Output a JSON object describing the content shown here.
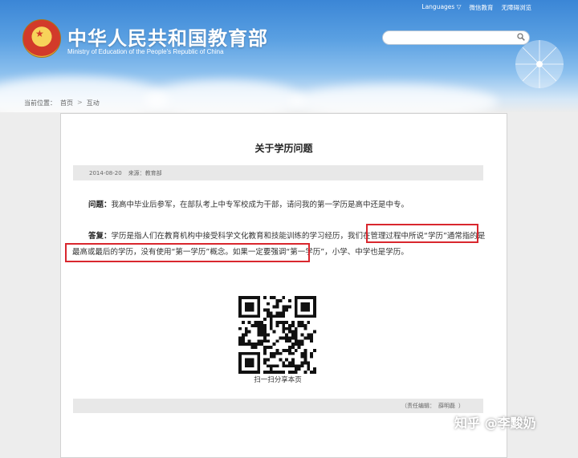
{
  "top_nav": {
    "languages": "Languages",
    "languages_caret": "▽",
    "mobile": "微信教育",
    "accessibility": "无障碍浏览"
  },
  "site": {
    "title": "中华人民共和国教育部",
    "subtitle": "Ministry of Education of the People's Republic of China"
  },
  "search": {
    "value": "",
    "placeholder": ""
  },
  "breadcrumb": {
    "prefix": "当前位置：",
    "home": "首页",
    "separator": ">",
    "section": "互动"
  },
  "article": {
    "title": "关于学历问题",
    "date": "2014-08-20",
    "source_label": "来源：",
    "source": "教育部",
    "question_label": "问题：",
    "question": "我高中毕业后参军，在部队考上中专军校成为干部，请问我的第一学历是高中还是中专。",
    "answer_label": "答复：",
    "answer": "学历是指人们在教育机构中接受科学文化教育和技能训练的学习经历，我们在管理过程中所说“学历”通常指的是最高或最后的学历，没有使用“第一学历”概念。如果一定要强调“第一学历”，小学、中学也是学历。",
    "qr_caption": "扫一扫分享本页",
    "editor_label": "（责任编辑：",
    "editor": "薛明磊",
    "editor_close": "）"
  },
  "watermark": "知乎 @李黢奶",
  "colors": {
    "header_blue": "#3b86d6",
    "highlight_red": "#d9272e",
    "bar_gray": "#e8e8e8"
  }
}
